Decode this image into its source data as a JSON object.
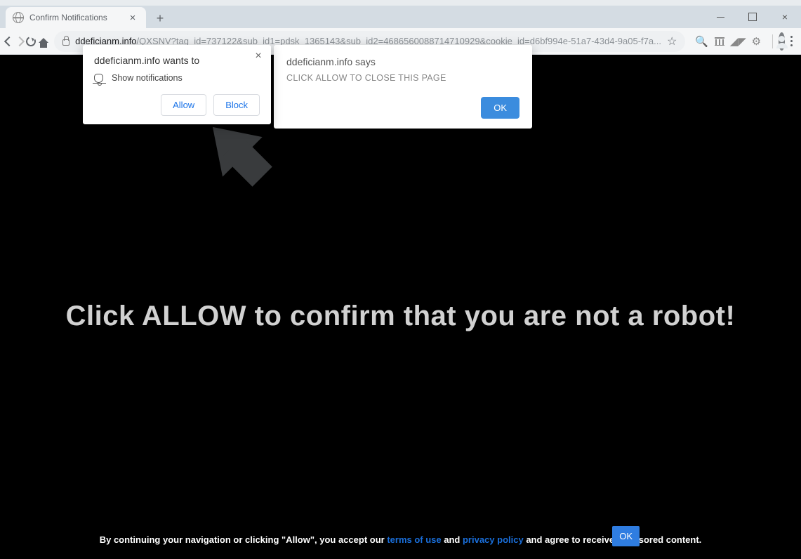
{
  "tab": {
    "title": "Confirm Notifications"
  },
  "url": {
    "domain": "ddeficianm.info",
    "path": "/QXSNV?tag_id=737122&sub_id1=pdsk_1365143&sub_id2=4686560088714710929&cookie_id=d6bf994e-51a7-43d4-9a05-f7a..."
  },
  "permissionPopup": {
    "title": "ddeficianm.info wants to",
    "item": "Show notifications",
    "allow": "Allow",
    "block": "Block"
  },
  "alertPopup": {
    "title": "ddeficianm.info says",
    "message": "CLICK ALLOW TO CLOSE THIS PAGE",
    "ok": "OK"
  },
  "page": {
    "hero": "Click ALLOW to confirm that you are not a robot!",
    "footer_pre": "By continuing your navigation or clicking \"Allow\", you accept our ",
    "terms": "terms of use",
    "and": " and ",
    "privacy": "privacy policy",
    "footer_post": " and agree to receive sponsored content.",
    "ok": "OK"
  }
}
